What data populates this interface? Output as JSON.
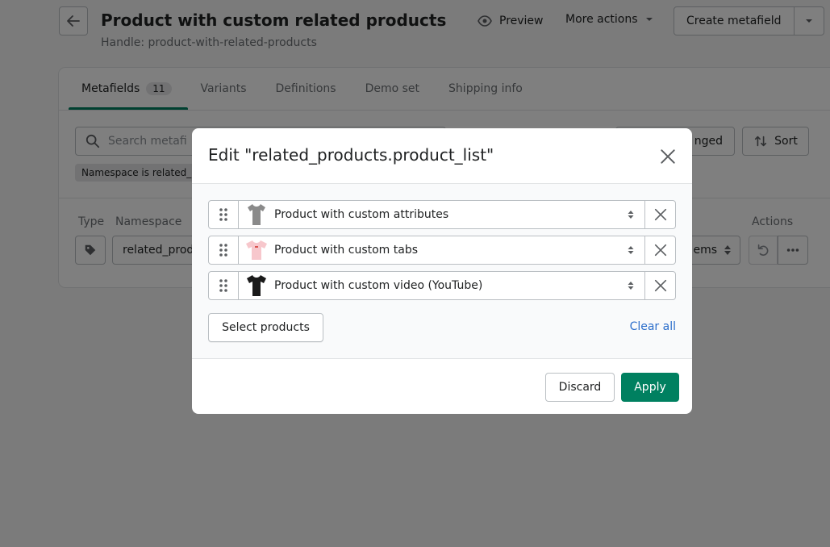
{
  "page": {
    "title": "Product with custom related products",
    "handle": "Handle: product-with-related-products",
    "preview_label": "Preview",
    "more_actions_label": "More actions",
    "create_metafield_label": "Create metafield"
  },
  "tabs": [
    {
      "label": "Metafields",
      "count": "11"
    },
    {
      "label": "Variants"
    },
    {
      "label": "Definitions"
    },
    {
      "label": "Demo set"
    },
    {
      "label": "Shipping info"
    }
  ],
  "toolbar": {
    "search_placeholder": "Search metafi",
    "changed_label": "nged",
    "sort_label": "Sort",
    "filter_tag": "Namespace is related_"
  },
  "table": {
    "col_type": "Type",
    "col_namespace": "Namespace",
    "col_actions": "Actions",
    "row_namespace": "related_prod",
    "row_items": "ems"
  },
  "modal": {
    "title": "Edit \"related_products.product_list\"",
    "items": [
      {
        "label": "Product with custom attributes",
        "shirt_color": "#8a8a8a"
      },
      {
        "label": "Product with custom tabs",
        "shirt_color": "#f7c7cc"
      },
      {
        "label": "Product with custom video (YouTube)",
        "shirt_color": "#1a1a1a"
      }
    ],
    "select_products_label": "Select products",
    "clear_all_label": "Clear all",
    "discard_label": "Discard",
    "apply_label": "Apply"
  },
  "colors": {
    "primary": "#008060",
    "link": "#2c6ecb"
  }
}
